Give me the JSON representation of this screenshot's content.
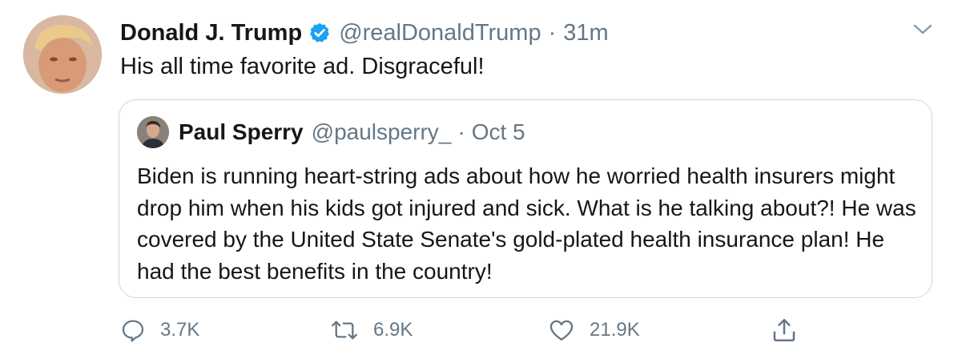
{
  "tweet": {
    "author_name": "Donald J. Trump",
    "author_handle": "@realDonaldTrump",
    "separator": "·",
    "time": "31m",
    "text": "His all time favorite ad. Disgraceful!"
  },
  "quoted_tweet": {
    "author_name": "Paul Sperry",
    "author_handle": "@paulsperry_",
    "separator": "·",
    "time": "Oct 5",
    "text": "Biden is running heart-string ads about how he worried health insurers might drop him when his kids got injured and sick. What is he talking about?! He was covered by the United State Senate's gold-plated health insurance plan! He had the best benefits in the country!"
  },
  "actions": {
    "reply_count": "3.7K",
    "retweet_count": "6.9K",
    "like_count": "21.9K"
  },
  "icons": {
    "verified": "verified-badge-icon",
    "caret": "chevron-down-icon",
    "reply": "reply-icon",
    "retweet": "retweet-icon",
    "like": "heart-icon",
    "share": "share-icon"
  },
  "colors": {
    "accent": "#1da1f2",
    "secondary_text": "#657786",
    "primary_text": "#14171a",
    "border": "#ccd6dd"
  }
}
